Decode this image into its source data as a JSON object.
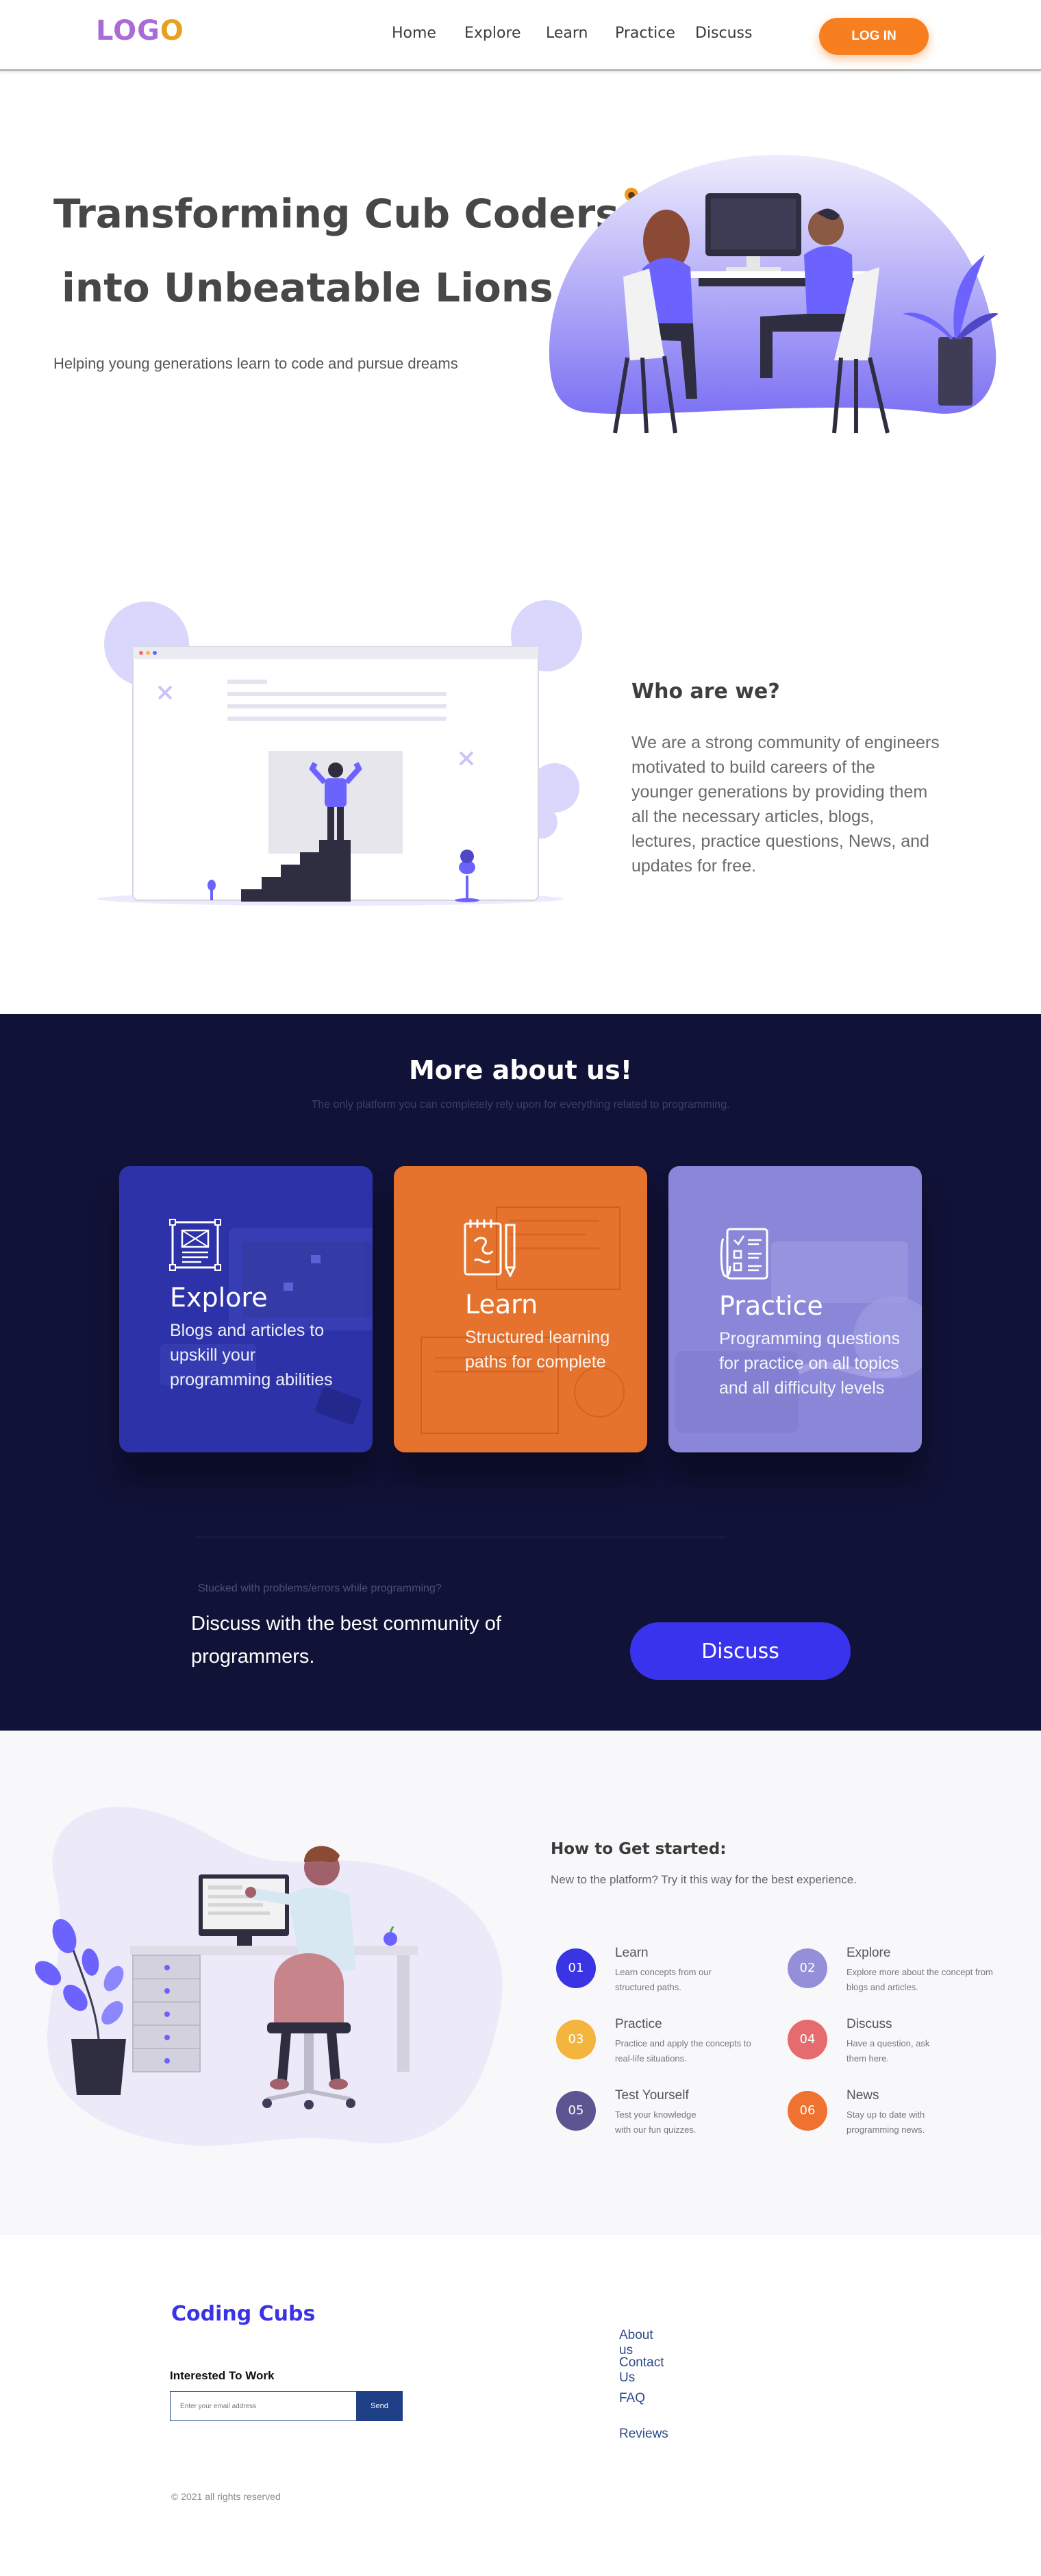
{
  "nav": {
    "logo": "LOGO",
    "links": [
      "Home",
      "Explore",
      "Learn",
      "Practice",
      "Discuss"
    ],
    "login": "LOG IN"
  },
  "hero": {
    "title_line1": "Transforming Cub Coders",
    "title_line2": "into Unbeatable Lions",
    "subtitle": "Helping young generations learn to code and pursue dreams",
    "title_emoji": "tiger-face-icon"
  },
  "about": {
    "title": "Who are we?",
    "text": "We are a strong community of engineers motivated to build careers of the younger generations by providing them all the necessary articles, blogs, lectures, practice questions, News, and updates for free."
  },
  "more": {
    "title": "More about us!",
    "subtitle": "The only platform you can completely rely upon for everything related to programming.",
    "cards": [
      {
        "title": "Explore",
        "desc": "Blogs and articles to upskill your programming abilities",
        "color": "#2a2fa0",
        "icon": "newspaper-icon"
      },
      {
        "title": "Learn",
        "desc": "Structured learning paths for complete",
        "color": "#e5732e",
        "icon": "notebook-pencil-icon"
      },
      {
        "title": "Practice",
        "desc": "Programming questions for practice on all topics and all difficulty levels",
        "color": "#8b87d8",
        "icon": "checklist-icon"
      }
    ]
  },
  "discuss": {
    "stuck": "Stucked with problems/errors while programming?",
    "text": "Discuss with the best community of programmers.",
    "button": "Discuss"
  },
  "started": {
    "title": "How to Get started:",
    "subtitle": "New to the platform? Try it this way for the best experience.",
    "steps": [
      {
        "num": "01",
        "title": "Learn",
        "desc": "Learn concepts from our structured paths.",
        "color": "#3b34e4"
      },
      {
        "num": "02",
        "title": "Explore",
        "desc": "Explore more about the concept from blogs and articles.",
        "color": "#948fd8"
      },
      {
        "num": "03",
        "title": "Practice",
        "desc": "Practice and apply the concepts to real-life situations.",
        "color": "#f4b53f"
      },
      {
        "num": "04",
        "title": "Discuss",
        "desc": "Have a question, ask them here.",
        "color": "#e56b6f"
      },
      {
        "num": "05",
        "title": "Test Yourself",
        "desc": "Test your knowledge with our fun quizzes.",
        "color": "#5b5691"
      },
      {
        "num": "06",
        "title": "News",
        "desc": "Stay up to date with programming news.",
        "color": "#ef7230"
      }
    ]
  },
  "footer": {
    "brand": "Coding Cubs",
    "interested": "Interested To Work",
    "email_placeholder": "Enter your email address",
    "send": "Send",
    "links": [
      "About us",
      "Contact Us",
      "FAQ",
      "Reviews"
    ],
    "copyright": "© 2021 all rights reserved"
  }
}
